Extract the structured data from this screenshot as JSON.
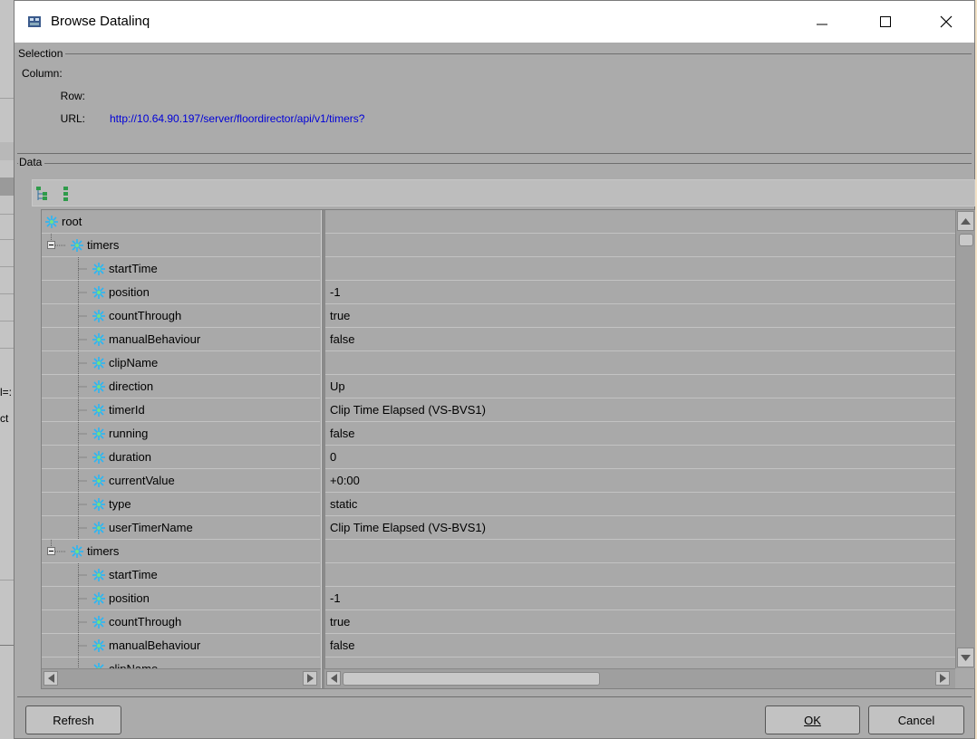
{
  "window": {
    "title": "Browse Datalinq"
  },
  "background": {
    "texts": [
      "l=:",
      "ct"
    ]
  },
  "selection": {
    "group_label": "Selection",
    "column_label": "Column:",
    "row_label": "Row:",
    "url_label": "URL:",
    "url_value": "http://10.64.90.197/server/floordirector/api/v1/timers?"
  },
  "data": {
    "group_label": "Data",
    "rows": [
      {
        "label": "root",
        "value": "",
        "level": 0,
        "expander": ""
      },
      {
        "label": "timers",
        "value": "",
        "level": 1,
        "expander": "minus"
      },
      {
        "label": "startTime",
        "value": "",
        "level": 2,
        "expander": ""
      },
      {
        "label": "position",
        "value": "-1",
        "level": 2,
        "expander": ""
      },
      {
        "label": "countThrough",
        "value": "true",
        "level": 2,
        "expander": ""
      },
      {
        "label": "manualBehaviour",
        "value": "false",
        "level": 2,
        "expander": ""
      },
      {
        "label": "clipName",
        "value": "",
        "level": 2,
        "expander": ""
      },
      {
        "label": "direction",
        "value": "Up",
        "level": 2,
        "expander": ""
      },
      {
        "label": "timerId",
        "value": "Clip Time Elapsed (VS-BVS1)",
        "level": 2,
        "expander": ""
      },
      {
        "label": "running",
        "value": "false",
        "level": 2,
        "expander": ""
      },
      {
        "label": "duration",
        "value": "0",
        "level": 2,
        "expander": ""
      },
      {
        "label": "currentValue",
        "value": "+0:00",
        "level": 2,
        "expander": ""
      },
      {
        "label": "type",
        "value": "static",
        "level": 2,
        "expander": ""
      },
      {
        "label": "userTimerName",
        "value": "Clip Time Elapsed (VS-BVS1)",
        "level": 2,
        "expander": ""
      },
      {
        "label": "timers",
        "value": "",
        "level": 1,
        "expander": "minus"
      },
      {
        "label": "startTime",
        "value": "",
        "level": 2,
        "expander": ""
      },
      {
        "label": "position",
        "value": "-1",
        "level": 2,
        "expander": ""
      },
      {
        "label": "countThrough",
        "value": "true",
        "level": 2,
        "expander": ""
      },
      {
        "label": "manualBehaviour",
        "value": "false",
        "level": 2,
        "expander": ""
      },
      {
        "label": "clipName",
        "value": "",
        "level": 2,
        "expander": ""
      }
    ]
  },
  "buttons": {
    "refresh": "Refresh",
    "ok": "OK",
    "cancel": "Cancel"
  },
  "colors": {
    "url": "#0000d8",
    "node_icon": "#29b6f6",
    "panel_bg": "#ababab"
  }
}
